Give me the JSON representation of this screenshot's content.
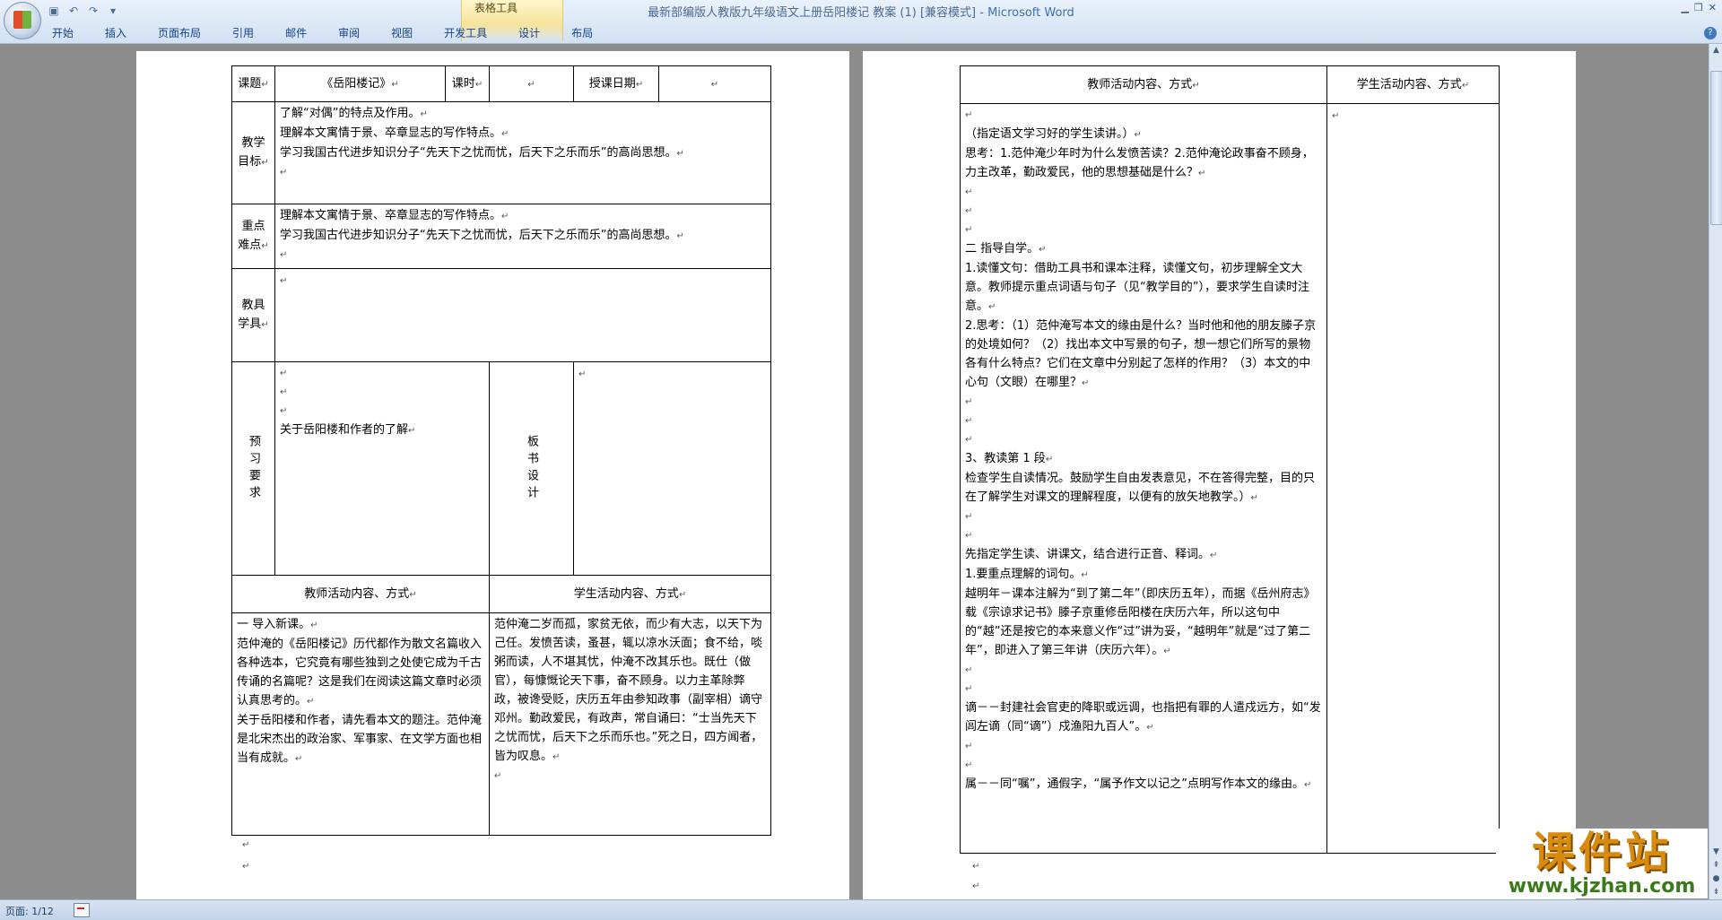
{
  "window": {
    "doc_title": "最新部编版人教版九年级语文上册岳阳楼记 教案 (1) [兼容模式] - ",
    "app_name": "Microsoft Word",
    "contextual_tab_group": "表格工具"
  },
  "ribbon": {
    "tabs": [
      "开始",
      "插入",
      "页面布局",
      "引用",
      "邮件",
      "审阅",
      "视图",
      "开发工具",
      "设计",
      "布局"
    ]
  },
  "page1": {
    "header_row": {
      "topic_label": "课题",
      "topic_value": "《岳阳楼记》",
      "hours_label": "课时",
      "date_label": "授课日期"
    },
    "goals_label": "教学目标",
    "goals": [
      "了解“对偶”的特点及作用。",
      "理解本文寓情于景、卒章显志的写作特点。",
      "学习我国古代进步知识分子“先天下之忧而忧，后天下之乐而乐”的高尚思想。"
    ],
    "keypoints_label": "重点难点",
    "keypoints": [
      "理解本文寓情于景、卒章显志的写作特点。",
      "学习我国古代进步知识分子“先天下之忧而忧，后天下之乐而乐”的高尚思想。"
    ],
    "tools_label": "教具学具",
    "preview_label": "预习要求",
    "preview_text": "关于岳阳楼和作者的了解",
    "board_label": "板书设计",
    "teacher_col": "教师活动内容、方式",
    "student_col": "学生活动内容、方式",
    "teacher_content": [
      "一  导入新课。",
      "范仲淹的《岳阳楼记》历代都作为散文名篇收入各种选本，它究竟有哪些独到之处使它成为千古传诵的名篇呢？这是我们在阅读这篇文章时必须认真思考的。",
      "关于岳阳楼和作者，请先看本文的题注。范仲淹是北宋杰出的政治家、军事家、在文学方面也相当有成就。"
    ],
    "student_content": [
      "范仲淹二岁而孤，家贫无依，而少有大志，以天下为己任。发愤苦读，蚤甚，辄以凉水沃面；食不给，啖粥而读，人不堪其忧，仲淹不改其乐也。既仕（做官），每慷慨论天下事，奋不顾身。以力主革除弊政，被谗受贬，庆历五年由参知政事（副宰相）谪守邓州。勤政爱民，有政声，常自诵曰：“士当先天下之忧而忧，后天下之乐而乐也。”死之日，四方闻者，皆为叹息。"
    ]
  },
  "page2": {
    "teacher_col": "教师活动内容、方式",
    "student_col": "学生活动内容、方式",
    "teacher_blocks": [
      {
        "text": "（指定语文学习好的学生读讲。）",
        "blank_before": 1
      },
      {
        "text": "思考：1.范仲淹少年时为什么发愤苦读？2.范仲淹论政事奋不顾身，力主改革，勤政爱民，他的思想基础是什么？",
        "blank_before": 0
      },
      {
        "text": "二  指导自学。",
        "blank_before": 3
      },
      {
        "text": "1.读懂文句：借助工具书和课本注释，读懂文句，初步理解全文大意。教师提示重点词语与句子（见“教学目的”），要求学生自读时注意。",
        "blank_before": 0
      },
      {
        "text": "2.思考：（1）范仲淹写本文的缘由是什么？当时他和他的朋友滕子京的处境如何？（2）找出本文中写景的句子，想一想它们所写的景物各有什么特点？它们在文章中分别起了怎样的作用？（3）本文的中心句（文眼）在哪里？",
        "blank_before": 0
      },
      {
        "text": "3、教读第 1 段",
        "blank_before": 3
      },
      {
        "text": "检查学生自读情况。鼓励学生自由发表意见，不在答得完整，目的只在了解学生对课文的理解程度，以便有的放矢地教学。）",
        "blank_before": 0
      },
      {
        "text": "先指定学生读、讲课文，结合进行正音、释词。",
        "blank_before": 2
      },
      {
        "text": "1.要重点理解的词句。",
        "blank_before": 0
      },
      {
        "text": "越明年－课本注解为“到了第二年”（即庆历五年），而据《岳州府志》载《宗谅求记书》滕子京重修岳阳楼在庆历六年，所以这句中的“越”还是按它的本来意义作“过”讲为妥，“越明年”就是“过了第二年”，即进入了第三年讲（庆历六年）。",
        "blank_before": 0
      },
      {
        "text": "谪－－封建社会官吏的降职或远调，也指把有罪的人遣戍远方，如“发闾左谪（同“谪”）戍渔阳九百人”。",
        "blank_before": 2
      },
      {
        "text": "属－－同“嘱”，通假字，“属予作文以记之”点明写作本文的缘由。",
        "blank_before": 2
      }
    ]
  },
  "statusbar": {
    "page_indicator": "页面: 1/12"
  },
  "watermark": {
    "brand": "课件站",
    "url": "www.kjzhan.com"
  }
}
